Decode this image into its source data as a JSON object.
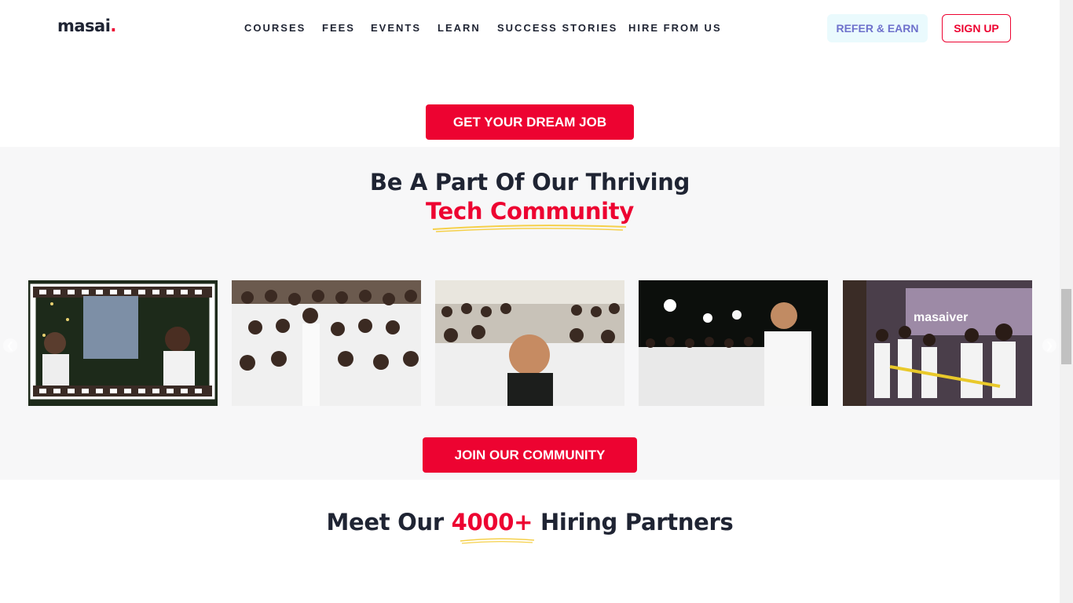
{
  "header": {
    "logo_text": "masai",
    "logo_dot": ".",
    "nav": [
      "COURSES",
      "FEES",
      "EVENTS",
      "LEARN",
      "SUCCESS STORIES",
      "HIRE FROM US"
    ],
    "refer_label": "REFER & EARN",
    "signup_label": "SIGN UP"
  },
  "cta_top": {
    "label": "GET YOUR DREAM JOB"
  },
  "community": {
    "title": "Be A Part Of Our Thriving",
    "highlight": "Tech Community",
    "photos": [
      {
        "name": "photo-frame-selfie"
      },
      {
        "name": "photo-group-seated"
      },
      {
        "name": "photo-group-selfie"
      },
      {
        "name": "photo-night-event"
      },
      {
        "name": "photo-tug-of-war"
      }
    ],
    "join_label": "JOIN OUR COMMUNITY",
    "prev_icon": "chevron-left-icon",
    "next_icon": "chevron-right-icon"
  },
  "partners": {
    "prefix": "Meet Our",
    "number": "4000+",
    "suffix": "Hiring Partners"
  },
  "colors": {
    "brand_red": "#ed0331",
    "dark_text": "#1f2433",
    "refer_bg": "#eafafd",
    "refer_text": "#6e71cc",
    "section_bg": "#f7f7f8",
    "underline_yellow": "#f5d04a"
  }
}
